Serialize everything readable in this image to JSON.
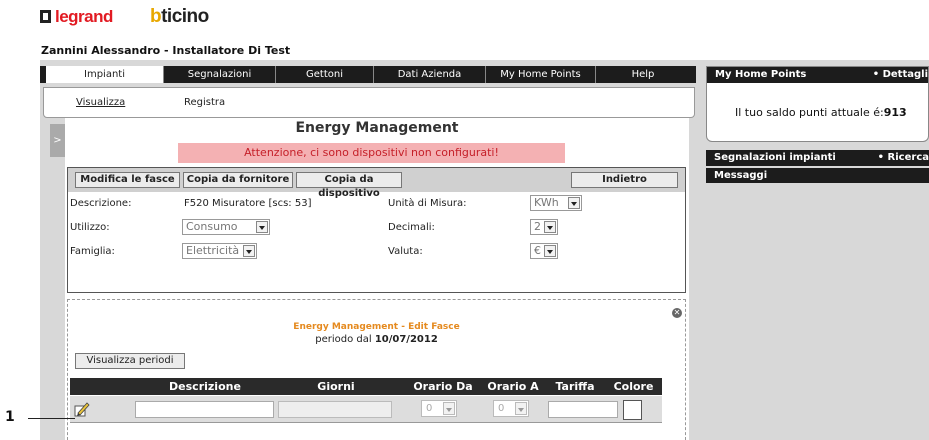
{
  "brand": {
    "left": "legrand",
    "right": "bticino"
  },
  "user": "Zannini Alessandro - Installatore Di Test",
  "tabs": [
    "Impianti",
    "Segnalazioni",
    "Gettoni",
    "Dati Azienda",
    "My Home Points",
    "Help"
  ],
  "subnav": [
    "Visualizza",
    "Registra"
  ],
  "collapse_glyph": ">",
  "page_title": "Energy Management",
  "warning": "Attenzione, ci sono dispositivi non configurati!",
  "toolbar": {
    "modifica": "Modifica le fasce",
    "copia_fornitore": "Copia da fornitore",
    "copia_dispositivo": "Copia da dispositivo",
    "indietro": "Indietro"
  },
  "form": {
    "descrizione_label": "Descrizione:",
    "descrizione_value": "F520 Misuratore [scs: 53]",
    "utilizzo_label": "Utilizzo:",
    "utilizzo_value": "Consumo",
    "famiglia_label": "Famiglia:",
    "famiglia_value": "Elettricità",
    "unita_label": "Unità di Misura:",
    "unita_value": "KWh",
    "decimali_label": "Decimali:",
    "decimali_value": "2",
    "valuta_label": "Valuta:",
    "valuta_value": "€"
  },
  "edit_fasce": {
    "title": "Energy Management - Edit Fasce",
    "period_prefix": "periodo dal",
    "period_date": "10/07/2012",
    "visualizza_button": "Visualizza periodi"
  },
  "table": {
    "headers": [
      "Descrizione",
      "Giorni",
      "Orario Da",
      "Orario A",
      "Tariffa",
      "Colore"
    ],
    "row": {
      "orario_da": "0",
      "orario_a": "0"
    }
  },
  "callout": "1",
  "right": {
    "my_home_points": "My Home Points",
    "dettagli": "• Dettagli",
    "saldo_label": "Il tuo saldo punti attuale é:",
    "saldo_value": "913",
    "segnalazioni": "Segnalazioni impianti",
    "ricerca": "• Ricerca",
    "messaggi": "Messaggi"
  }
}
